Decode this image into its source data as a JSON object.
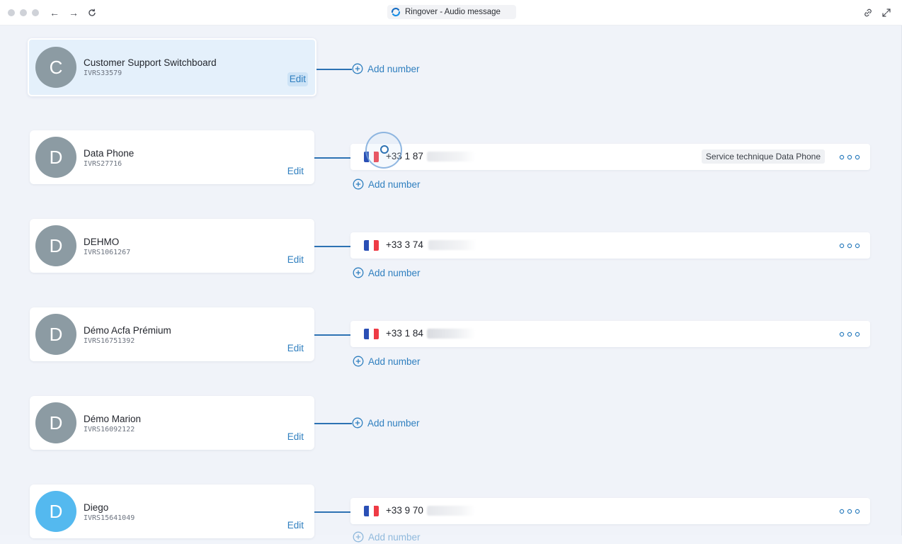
{
  "window": {
    "title": "Ringover - Audio message"
  },
  "colors": {
    "accent": "#2f7fbf",
    "avatar_default": "#8c9ba3",
    "avatar_highlight": "#54b9ef"
  },
  "ivrs": [
    {
      "initial": "C",
      "name": "Customer Support Switchboard",
      "id": "IVRS33579",
      "edit": "Edit",
      "add_number": "Add number",
      "numbers": []
    },
    {
      "initial": "D",
      "name": "Data Phone",
      "id": "IVRS27716",
      "edit": "Edit",
      "add_number": "Add number",
      "numbers": [
        {
          "country": "France",
          "phone": "+33 1 87",
          "tag": "Service technique Data Phone"
        }
      ]
    },
    {
      "initial": "D",
      "name": "DEHMO",
      "id": "IVRS1061267",
      "edit": "Edit",
      "add_number": "Add number",
      "numbers": [
        {
          "country": "France",
          "phone": "+33 3 74",
          "tag": ""
        }
      ]
    },
    {
      "initial": "D",
      "name": "Démo Acfa Prémium",
      "id": "IVRS16751392",
      "edit": "Edit",
      "add_number": "Add number",
      "numbers": [
        {
          "country": "France",
          "phone": "+33 1 84",
          "tag": ""
        }
      ]
    },
    {
      "initial": "D",
      "name": "Démo Marion",
      "id": "IVRS16092122",
      "edit": "Edit",
      "add_number": "Add number",
      "numbers": []
    },
    {
      "initial": "D",
      "name": "Diego",
      "id": "IVRS15641049",
      "edit": "Edit",
      "add_number": "Add number",
      "numbers": [
        {
          "country": "France",
          "phone": "+33 9 70",
          "tag": ""
        }
      ]
    }
  ]
}
